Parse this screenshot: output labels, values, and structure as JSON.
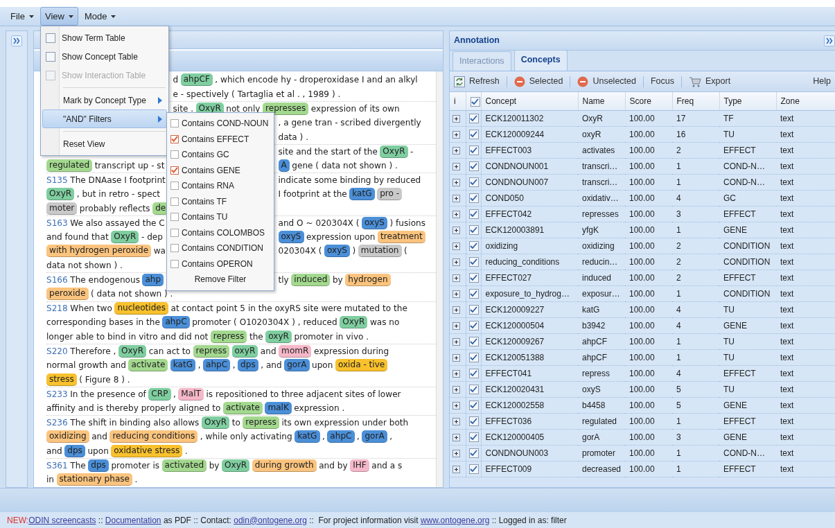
{
  "menubar": [
    {
      "label": "File",
      "open": false
    },
    {
      "label": "View",
      "open": true
    },
    {
      "label": "Mode",
      "open": false
    }
  ],
  "view_menu": {
    "items": [
      {
        "kind": "check",
        "label": "Show Term Table",
        "checked": false,
        "disabled": false
      },
      {
        "kind": "check",
        "label": "Show Concept Table",
        "checked": false,
        "disabled": false
      },
      {
        "kind": "check",
        "label": "Show Interaction Table",
        "checked": false,
        "disabled": true
      },
      {
        "kind": "separator"
      },
      {
        "kind": "submenu",
        "label": "Mark by Concept Type",
        "expanded": false
      },
      {
        "kind": "submenu",
        "label": "\"AND\" Filters",
        "expanded": true
      },
      {
        "kind": "separator"
      },
      {
        "kind": "action",
        "label": "Reset View"
      }
    ]
  },
  "filters_submenu": {
    "items": [
      {
        "kind": "check",
        "label": "Contains COND-NOUN",
        "checked": false
      },
      {
        "kind": "check",
        "label": "Contains EFFECT",
        "checked": true
      },
      {
        "kind": "check",
        "label": "Contains GC",
        "checked": false
      },
      {
        "kind": "check",
        "label": "Contains GENE",
        "checked": true
      },
      {
        "kind": "check",
        "label": "Contains RNA",
        "checked": false
      },
      {
        "kind": "check",
        "label": "Contains TF",
        "checked": false
      },
      {
        "kind": "check",
        "label": "Contains TU",
        "checked": false
      },
      {
        "kind": "check",
        "label": "Contains COLOMBOS",
        "checked": false
      },
      {
        "kind": "check",
        "label": "Contains CONDITION",
        "checked": false
      },
      {
        "kind": "check",
        "label": "Contains OPERON",
        "checked": false
      },
      {
        "kind": "action",
        "label": "Remove Filter"
      }
    ]
  },
  "document": {
    "lines": [
      {
        "rule_above": false,
        "segments": [
          {
            "kind": "gap"
          },
          {
            "kind": "text",
            "text": "d"
          },
          {
            "kind": "tag",
            "text": "ahpCF",
            "color": "#7fcea0"
          },
          {
            "kind": "text",
            "text": ", which encode hy - droperoxidase I and an alkyl"
          }
        ]
      },
      {
        "rule_above": false,
        "segments": [
          {
            "kind": "gap"
          },
          {
            "kind": "text",
            "text": "e - spectively ( Tartaglia et al . , 1989 ) ."
          }
        ]
      },
      {
        "rule_above": true,
        "segments": [
          {
            "kind": "gap"
          },
          {
            "kind": "text",
            "text": "site ."
          },
          {
            "kind": "tag",
            "text": "OxyR",
            "color": "#7fcea0"
          },
          {
            "kind": "text",
            "text": "not only"
          },
          {
            "kind": "tag",
            "text": "represses",
            "color": "#a3d98f"
          },
          {
            "kind": "text",
            "text": "expression of its own"
          }
        ]
      },
      {
        "rule_above": false,
        "segments": [
          {
            "kind": "gap"
          },
          {
            "kind": "text",
            "text": ", a gene tran - scribed divergently"
          }
        ]
      },
      {
        "rule_above": false,
        "segments": [
          {
            "kind": "gap"
          },
          {
            "kind": "text",
            "text": "data ) ."
          }
        ]
      },
      {
        "rule_above": true,
        "segments": [
          {
            "kind": "gap"
          },
          {
            "kind": "text",
            "text": "site and the start of the"
          },
          {
            "kind": "tag",
            "text": "OxyR",
            "color": "#7fcea0"
          },
          {
            "kind": "text",
            "text": "-"
          }
        ]
      },
      {
        "rule_above": false,
        "segments": [
          {
            "kind": "tag",
            "text": "regulated",
            "color": "#a3d98f"
          },
          {
            "kind": "text",
            "text": "transcript up - st"
          },
          {
            "kind": "gap"
          },
          {
            "kind": "tag",
            "text": "A",
            "color": "#4b8fd8"
          },
          {
            "kind": "text",
            "text": "gene ( data not shown ) ."
          }
        ]
      },
      {
        "rule_above": true,
        "segments": [
          {
            "kind": "id",
            "text": "S135"
          },
          {
            "kind": "text",
            "text": "The DNAase I footprint"
          },
          {
            "kind": "gap"
          },
          {
            "kind": "text",
            "text": "indicate some binding by reduced"
          }
        ]
      },
      {
        "rule_above": false,
        "segments": [
          {
            "kind": "tag",
            "text": "OxyR",
            "color": "#7fcea0"
          },
          {
            "kind": "text",
            "text": ", but in retro - spect"
          },
          {
            "kind": "gap"
          },
          {
            "kind": "text",
            "text": "I footprint at the"
          },
          {
            "kind": "tag",
            "text": "katG",
            "color": "#4b8fd8"
          },
          {
            "kind": "tag",
            "text": "pro -",
            "color": "#c9c9c9"
          }
        ]
      },
      {
        "rule_above": false,
        "segments": [
          {
            "kind": "tag",
            "text": "moter",
            "color": "#c9c9c9"
          },
          {
            "kind": "text",
            "text": "probably reflects"
          },
          {
            "kind": "tag",
            "text": "de",
            "color": "#a3d98f"
          },
          {
            "kind": "gap"
          }
        ]
      },
      {
        "rule_above": true,
        "segments": [
          {
            "kind": "id",
            "text": "S163"
          },
          {
            "kind": "text",
            "text": "We also assayed the C"
          },
          {
            "kind": "gap"
          },
          {
            "kind": "text",
            "text": "and O ~ 020304X ("
          },
          {
            "kind": "tag",
            "text": "oxyS",
            "color": "#4b8fd8"
          },
          {
            "kind": "text",
            "text": ") fusions"
          }
        ]
      },
      {
        "rule_above": false,
        "segments": [
          {
            "kind": "text",
            "text": "and found that"
          },
          {
            "kind": "tag",
            "text": "OxyR",
            "color": "#7fcea0"
          },
          {
            "kind": "text",
            "text": "- dep"
          },
          {
            "kind": "gap"
          },
          {
            "kind": "tag",
            "text": "oxyS",
            "color": "#4b8fd8"
          },
          {
            "kind": "text",
            "text": "expression upon"
          },
          {
            "kind": "tag",
            "text": "treatment",
            "color": "#fbc47e"
          }
        ]
      },
      {
        "rule_above": false,
        "segments": [
          {
            "kind": "tag",
            "text": "with hydrogen peroxide",
            "color": "#fbc47e"
          },
          {
            "kind": "text",
            "text": "wa"
          },
          {
            "kind": "gap"
          },
          {
            "kind": "text",
            "text": "020304X ("
          },
          {
            "kind": "tag",
            "text": "oxyS",
            "color": "#4b8fd8"
          },
          {
            "kind": "text",
            "text": ")"
          },
          {
            "kind": "tag",
            "text": "mutation",
            "color": "#c9c9c9"
          },
          {
            "kind": "text",
            "text": "("
          }
        ]
      },
      {
        "rule_above": false,
        "segments": [
          {
            "kind": "text",
            "text": "data not shown ) ."
          }
        ]
      },
      {
        "rule_above": true,
        "segments": [
          {
            "kind": "id",
            "text": "S166"
          },
          {
            "kind": "text",
            "text": "The endogenous"
          },
          {
            "kind": "tag",
            "text": "ahp",
            "color": "#4b8fd8"
          },
          {
            "kind": "gap"
          },
          {
            "kind": "text",
            "text": "tly"
          },
          {
            "kind": "tag",
            "text": "induced",
            "color": "#a3d98f"
          },
          {
            "kind": "text",
            "text": "by"
          },
          {
            "kind": "tag",
            "text": "hydrogen",
            "color": "#fbc47e"
          }
        ]
      },
      {
        "rule_above": false,
        "segments": [
          {
            "kind": "tag",
            "text": "peroxide",
            "color": "#fbc47e"
          },
          {
            "kind": "text",
            "text": "( data not shown ) ."
          }
        ]
      },
      {
        "rule_above": true,
        "segments": [
          {
            "kind": "id",
            "text": "S218"
          },
          {
            "kind": "text",
            "text": "When two"
          },
          {
            "kind": "tag",
            "text": "nucleotides",
            "color": "#f8c12d"
          },
          {
            "kind": "text",
            "text": "at contact point 5 in the oxyRS site were mutated to the"
          }
        ]
      },
      {
        "rule_above": false,
        "segments": [
          {
            "kind": "text",
            "text": "corresponding bases in the"
          },
          {
            "kind": "tag",
            "text": "ahpC",
            "color": "#4b8fd8"
          },
          {
            "kind": "text",
            "text": "promoter ( O1020304X ) , reduced"
          },
          {
            "kind": "tag",
            "text": "OxyR",
            "color": "#7fcea0"
          },
          {
            "kind": "text",
            "text": "was no"
          }
        ]
      },
      {
        "rule_above": false,
        "segments": [
          {
            "kind": "text",
            "text": "longer able to bind in vitro and did not"
          },
          {
            "kind": "tag",
            "text": "repress",
            "color": "#a3d98f"
          },
          {
            "kind": "text",
            "text": "the"
          },
          {
            "kind": "tag",
            "text": "oxyR",
            "color": "#7fcea0"
          },
          {
            "kind": "text",
            "text": "promoter in vivo ."
          }
        ]
      },
      {
        "rule_above": true,
        "segments": [
          {
            "kind": "id",
            "text": "S220"
          },
          {
            "kind": "text",
            "text": "Therefore ,"
          },
          {
            "kind": "tag",
            "text": "OxyR",
            "color": "#7fcea0"
          },
          {
            "kind": "text",
            "text": "can act to"
          },
          {
            "kind": "tag",
            "text": "repress",
            "color": "#a3d98f"
          },
          {
            "kind": "tag",
            "text": "oxyR",
            "color": "#7fcea0"
          },
          {
            "kind": "text",
            "text": "and"
          },
          {
            "kind": "tag",
            "text": "momR",
            "color": "#f5b8c8"
          },
          {
            "kind": "text",
            "text": "expression during"
          }
        ]
      },
      {
        "rule_above": false,
        "segments": [
          {
            "kind": "text",
            "text": "normal growth and"
          },
          {
            "kind": "tag",
            "text": "activate",
            "color": "#a3d98f"
          },
          {
            "kind": "tag",
            "text": "katG",
            "color": "#4b8fd8"
          },
          {
            "kind": "text",
            "text": ","
          },
          {
            "kind": "tag",
            "text": "ahpC",
            "color": "#4b8fd8"
          },
          {
            "kind": "text",
            "text": ","
          },
          {
            "kind": "tag",
            "text": "dps",
            "color": "#4b8fd8"
          },
          {
            "kind": "text",
            "text": ", and"
          },
          {
            "kind": "tag",
            "text": "gorA",
            "color": "#4b8fd8"
          },
          {
            "kind": "text",
            "text": "upon"
          },
          {
            "kind": "tag",
            "text": "oxida - tive",
            "color": "#f8c12d"
          }
        ]
      },
      {
        "rule_above": false,
        "segments": [
          {
            "kind": "tag",
            "text": "stress",
            "color": "#f8c12d"
          },
          {
            "kind": "text",
            "text": "( Figure 8 ) ."
          }
        ]
      },
      {
        "rule_above": true,
        "segments": [
          {
            "kind": "id",
            "text": "S233"
          },
          {
            "kind": "text",
            "text": "In the presence of"
          },
          {
            "kind": "tag",
            "text": "CRP",
            "color": "#7fcea0"
          },
          {
            "kind": "text",
            "text": ","
          },
          {
            "kind": "tag",
            "text": "MalT",
            "color": "#f5b8c8"
          },
          {
            "kind": "text",
            "text": "is repositioned to three adjacent sites of lower"
          }
        ]
      },
      {
        "rule_above": false,
        "segments": [
          {
            "kind": "text",
            "text": "affinity and is thereby properly aligned to"
          },
          {
            "kind": "tag",
            "text": "activate",
            "color": "#a3d98f"
          },
          {
            "kind": "tag",
            "text": "malK",
            "color": "#4b8fd8"
          },
          {
            "kind": "text",
            "text": "expression ."
          }
        ]
      },
      {
        "rule_above": true,
        "segments": [
          {
            "kind": "id",
            "text": "S236"
          },
          {
            "kind": "text",
            "text": "The shift in binding also allows"
          },
          {
            "kind": "tag",
            "text": "OxyR",
            "color": "#7fcea0"
          },
          {
            "kind": "text",
            "text": "to"
          },
          {
            "kind": "tag",
            "text": "repress",
            "color": "#a3d98f"
          },
          {
            "kind": "text",
            "text": "its own expression under both"
          }
        ]
      },
      {
        "rule_above": false,
        "segments": [
          {
            "kind": "tag",
            "text": "oxidizing",
            "color": "#fbc47e"
          },
          {
            "kind": "text",
            "text": "and"
          },
          {
            "kind": "tag",
            "text": "reducing conditions",
            "color": "#fbc47e"
          },
          {
            "kind": "text",
            "text": ", while only activating"
          },
          {
            "kind": "tag",
            "text": "katG",
            "color": "#4b8fd8"
          },
          {
            "kind": "text",
            "text": ","
          },
          {
            "kind": "tag",
            "text": "ahpC",
            "color": "#4b8fd8"
          },
          {
            "kind": "text",
            "text": ","
          },
          {
            "kind": "tag",
            "text": "gorA",
            "color": "#4b8fd8"
          },
          {
            "kind": "text",
            "text": ","
          }
        ]
      },
      {
        "rule_above": false,
        "segments": [
          {
            "kind": "text",
            "text": "and"
          },
          {
            "kind": "tag",
            "text": "dps",
            "color": "#4b8fd8"
          },
          {
            "kind": "text",
            "text": "upon"
          },
          {
            "kind": "tag",
            "text": "oxidative stress",
            "color": "#f8c12d"
          },
          {
            "kind": "text",
            "text": "."
          }
        ]
      },
      {
        "rule_above": true,
        "segments": [
          {
            "kind": "id",
            "text": "S361"
          },
          {
            "kind": "text",
            "text": "The"
          },
          {
            "kind": "tag",
            "text": "dps",
            "color": "#4b8fd8"
          },
          {
            "kind": "text",
            "text": "promoter is"
          },
          {
            "kind": "tag",
            "text": "activated",
            "color": "#a3d98f"
          },
          {
            "kind": "text",
            "text": "by"
          },
          {
            "kind": "tag",
            "text": "OxyR",
            "color": "#7fcea0"
          },
          {
            "kind": "tag",
            "text": "during growth",
            "color": "#fbc47e"
          },
          {
            "kind": "text",
            "text": "and by"
          },
          {
            "kind": "tag",
            "text": "IHF",
            "color": "#f5b8c8"
          },
          {
            "kind": "text",
            "text": "and a s"
          }
        ]
      },
      {
        "rule_above": false,
        "segments": [
          {
            "kind": "text",
            "text": "in"
          },
          {
            "kind": "tag",
            "text": "stationary phase",
            "color": "#fbc47e"
          },
          {
            "kind": "text",
            "text": "."
          }
        ]
      }
    ]
  },
  "annotation": {
    "title": "Annotation",
    "tabs": [
      {
        "label": "Interactions",
        "selected": false
      },
      {
        "label": "Concepts",
        "selected": true
      }
    ],
    "toolbar": [
      {
        "kind": "refresh",
        "label": "Refresh"
      },
      {
        "kind": "remove",
        "label": "Selected"
      },
      {
        "kind": "remove",
        "label": "Unselected"
      },
      {
        "kind": "plain",
        "label": "Focus"
      },
      {
        "kind": "cart",
        "label": "Export"
      },
      {
        "kind": "plain",
        "label": "Help"
      }
    ],
    "table": {
      "columns": [
        "i",
        "",
        "Concept",
        "Name",
        "Score",
        "Freq",
        "Type",
        "Zone"
      ],
      "select_all_checked": true,
      "rows": [
        {
          "checked": true,
          "cells": [
            "",
            "",
            "ECK120011302",
            "OxyR",
            "100.00",
            "17",
            "TF",
            "text"
          ]
        },
        {
          "checked": true,
          "cells": [
            "",
            "",
            "ECK120009244",
            "oxyR",
            "100.00",
            "16",
            "TU",
            "text"
          ]
        },
        {
          "checked": true,
          "cells": [
            "",
            "",
            "EFFECT003",
            "activates",
            "100.00",
            "2",
            "EFFECT",
            "text"
          ]
        },
        {
          "checked": true,
          "cells": [
            "",
            "",
            "CONDNOUN001",
            "transcri…",
            "100.00",
            "1",
            "COND-N…",
            "text"
          ]
        },
        {
          "checked": true,
          "cells": [
            "",
            "",
            "CONDNOUN007",
            "transcri…",
            "100.00",
            "1",
            "COND-N…",
            "text"
          ]
        },
        {
          "checked": true,
          "cells": [
            "",
            "",
            "COND050",
            "oxidativ…",
            "100.00",
            "4",
            "GC",
            "text"
          ]
        },
        {
          "checked": true,
          "cells": [
            "",
            "",
            "EFFECT042",
            "represses",
            "100.00",
            "3",
            "EFFECT",
            "text"
          ]
        },
        {
          "checked": true,
          "cells": [
            "",
            "",
            "ECK120003891",
            "yfgK",
            "100.00",
            "1",
            "GENE",
            "text"
          ]
        },
        {
          "checked": true,
          "cells": [
            "",
            "",
            "oxidizing",
            "oxidizing",
            "100.00",
            "2",
            "CONDITION",
            "text"
          ]
        },
        {
          "checked": true,
          "cells": [
            "",
            "",
            "reducing_conditions",
            "reducin…",
            "100.00",
            "2",
            "CONDITION",
            "text"
          ]
        },
        {
          "checked": true,
          "cells": [
            "",
            "",
            "EFFECT027",
            "induced",
            "100.00",
            "2",
            "EFFECT",
            "text"
          ]
        },
        {
          "checked": true,
          "cells": [
            "",
            "",
            "exposure_to_hydrog…",
            "exposur…",
            "100.00",
            "1",
            "CONDITION",
            "text"
          ]
        },
        {
          "checked": true,
          "cells": [
            "",
            "",
            "ECK120009227",
            "katG",
            "100.00",
            "4",
            "TU",
            "text"
          ]
        },
        {
          "checked": true,
          "cells": [
            "",
            "",
            "ECK120000504",
            "b3942",
            "100.00",
            "4",
            "GENE",
            "text"
          ]
        },
        {
          "checked": true,
          "cells": [
            "",
            "",
            "ECK120009267",
            "ahpCF",
            "100.00",
            "1",
            "TU",
            "text"
          ]
        },
        {
          "checked": true,
          "cells": [
            "",
            "",
            "ECK120051388",
            "ahpCF",
            "100.00",
            "1",
            "TU",
            "text"
          ]
        },
        {
          "checked": true,
          "cells": [
            "",
            "",
            "EFFECT041",
            "repress",
            "100.00",
            "4",
            "EFFECT",
            "text"
          ]
        },
        {
          "checked": true,
          "cells": [
            "",
            "",
            "ECK120020431",
            "oxyS",
            "100.00",
            "5",
            "TU",
            "text"
          ]
        },
        {
          "checked": true,
          "cells": [
            "",
            "",
            "ECK120002558",
            "b4458",
            "100.00",
            "5",
            "GENE",
            "text"
          ]
        },
        {
          "checked": true,
          "cells": [
            "",
            "",
            "EFFECT036",
            "regulated",
            "100.00",
            "1",
            "EFFECT",
            "text"
          ]
        },
        {
          "checked": true,
          "cells": [
            "",
            "",
            "ECK120000405",
            "gorA",
            "100.00",
            "3",
            "GENE",
            "text"
          ]
        },
        {
          "checked": true,
          "cells": [
            "",
            "",
            "CONDNOUN003",
            "promoter",
            "100.00",
            "1",
            "COND-N…",
            "text"
          ]
        },
        {
          "checked": true,
          "cells": [
            "",
            "",
            "EFFECT009",
            "decreased",
            "100.00",
            "1",
            "EFFECT",
            "text"
          ]
        }
      ]
    }
  },
  "footer": [
    {
      "kind": "alert",
      "text": "NEW:"
    },
    {
      "kind": "link",
      "text": "ODIN screencasts"
    },
    {
      "kind": "text",
      "text": " :: "
    },
    {
      "kind": "link",
      "text": "Documentation"
    },
    {
      "kind": "text",
      "text": " as PDF :: Contact: "
    },
    {
      "kind": "link",
      "text": "odin@ontogene.org"
    },
    {
      "kind": "text",
      "text": " ::  For project information visit "
    },
    {
      "kind": "link",
      "text": "www.ontogene.org"
    },
    {
      "kind": "text",
      "text": " :: Logged in as: filter"
    }
  ]
}
